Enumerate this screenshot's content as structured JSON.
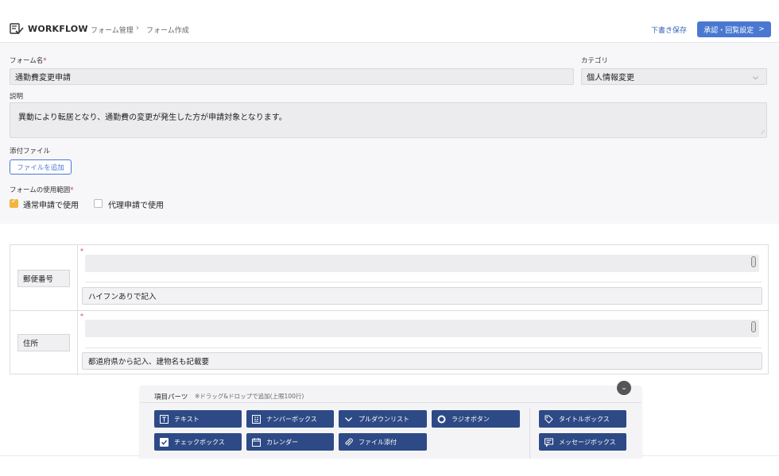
{
  "header": {
    "brand": "WORKFLOW",
    "breadcrumbs": [
      "フォーム管理",
      "フォーム作成"
    ],
    "draft_save": "下書き保存",
    "approve_button": "承認・回覧設定",
    "approve_chevron": ">"
  },
  "form": {
    "name_label": "フォーム名",
    "name_value": "通勤費変更申請",
    "category_label": "カテゴリ",
    "category_value": "個人情報変更",
    "description_label": "説明",
    "description_value": "異動により転居となり、通勤費の変更が発生した方が申請対象となります。",
    "attachment_label": "添付ファイル",
    "add_file_button": "ファイルを追加",
    "usage_label": "フォームの使用範囲",
    "usage_options": [
      {
        "label": "通常申請で使用",
        "checked": true
      },
      {
        "label": "代理申請で使用",
        "checked": false
      }
    ],
    "required_mark": "*"
  },
  "rows": [
    {
      "label": "郵便番号",
      "hint": "ハイフンありで記入"
    },
    {
      "label": "住所",
      "hint": "都道府県から記入、建物名も記載要"
    }
  ],
  "parts": {
    "title": "項目パーツ",
    "note": "※ドラッグ&ドロップで追加(上限100行)",
    "buttons": [
      {
        "label": "テキスト",
        "icon": "text-icon"
      },
      {
        "label": "ナンバーボックス",
        "icon": "number-icon"
      },
      {
        "label": "プルダウンリスト",
        "icon": "chevron-down-icon"
      },
      {
        "label": "ラジオボタン",
        "icon": "radio-icon"
      },
      {
        "label": "タイトルボックス",
        "icon": "tag-icon"
      },
      {
        "label": "チェックボックス",
        "icon": "checkbox-icon"
      },
      {
        "label": "カレンダー",
        "icon": "calendar-icon"
      },
      {
        "label": "ファイル添付",
        "icon": "paperclip-icon"
      },
      {
        "label": "メッセージボックス",
        "icon": "message-icon"
      }
    ]
  },
  "colors": {
    "accent": "#4a78d1",
    "part_button": "#2e4a86",
    "required": "#d23c3c",
    "checkbox_on": "#f2b542"
  }
}
